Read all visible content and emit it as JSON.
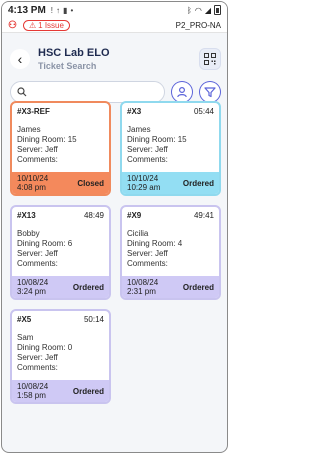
{
  "status_bar": {
    "time": "4:13 PM"
  },
  "issue_bar": {
    "issue_label": "1 Issue",
    "device": "P2_PRO-NA"
  },
  "header": {
    "title": "HSC Lab ELO",
    "subtitle": "Ticket Search"
  },
  "search": {
    "value": "",
    "placeholder": ""
  },
  "cards": [
    {
      "id": "#X3-REF",
      "time": "",
      "name": "James",
      "dining_room": "Dining Room: 15",
      "server": "Server: Jeff",
      "comments": "Comments:",
      "date": "10/10/24",
      "clock": "4:08 pm",
      "status": "Closed"
    },
    {
      "id": "#X3",
      "time": "05:44",
      "name": "James",
      "dining_room": "Dining Room: 15",
      "server": "Server: Jeff",
      "comments": "Comments:",
      "date": "10/10/24",
      "clock": "10:29 am",
      "status": "Ordered"
    },
    {
      "id": "#X13",
      "time": "48:49",
      "name": "Bobby",
      "dining_room": "Dining Room: 6",
      "server": "Server: Jeff",
      "comments": "Comments:",
      "date": "10/08/24",
      "clock": "3:24 pm",
      "status": "Ordered"
    },
    {
      "id": "#X9",
      "time": "49:41",
      "name": "Cicilia",
      "dining_room": "Dining Room: 4",
      "server": "Server: Jeff",
      "comments": "Comments:",
      "date": "10/08/24",
      "clock": "2:31 pm",
      "status": "Ordered"
    },
    {
      "id": "#X5",
      "time": "50:14",
      "name": "Sam",
      "dining_room": "Dining Room: 0",
      "server": "Server: Jeff",
      "comments": "Comments:",
      "date": "10/08/24",
      "clock": "1:58 pm",
      "status": "Ordered"
    }
  ],
  "colors": {
    "closed": "#f4895c",
    "ordered_blue": "#93def3",
    "ordered_purple": "#cfc9f5",
    "accent": "#5b63d9"
  }
}
